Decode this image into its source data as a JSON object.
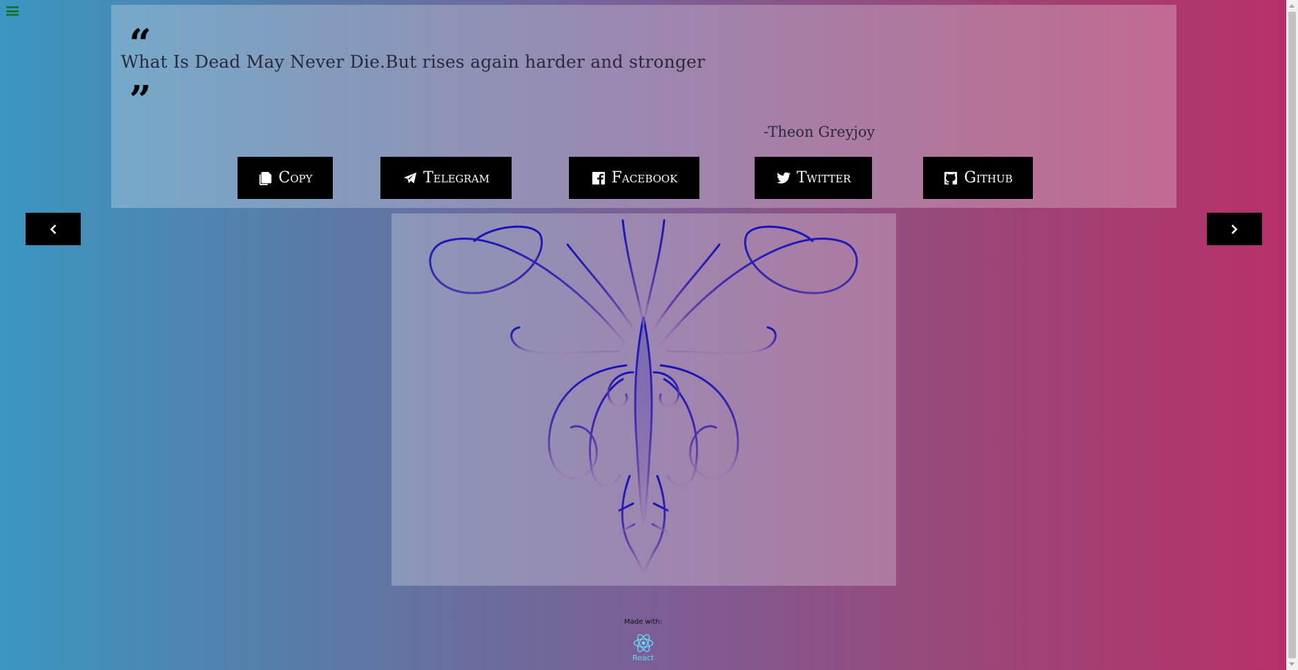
{
  "menu": {
    "icon": "hamburger-menu-icon",
    "color": "#17752f"
  },
  "quote": {
    "open_mark": "“",
    "text": "What Is Dead May Never Die.But rises again harder and stronger",
    "close_mark": "”",
    "author": "-Theon Greyjoy"
  },
  "share_buttons": [
    {
      "label": "Copy",
      "icon": "copy-icon"
    },
    {
      "label": "Telegram",
      "icon": "telegram-icon"
    },
    {
      "label": "Facebook",
      "icon": "facebook-icon"
    },
    {
      "label": "Twitter",
      "icon": "twitter-icon"
    },
    {
      "label": "Github",
      "icon": "github-icon"
    }
  ],
  "navigation": {
    "prev_icon": "chevron-left-icon",
    "next_icon": "chevron-right-icon"
  },
  "house_sigil": {
    "name": "greyjoy-kraken-sigil",
    "color": "#1a17b8"
  },
  "footer": {
    "made_with": "Made with:",
    "tech_label": "React",
    "tech_color": "#61dafb"
  }
}
